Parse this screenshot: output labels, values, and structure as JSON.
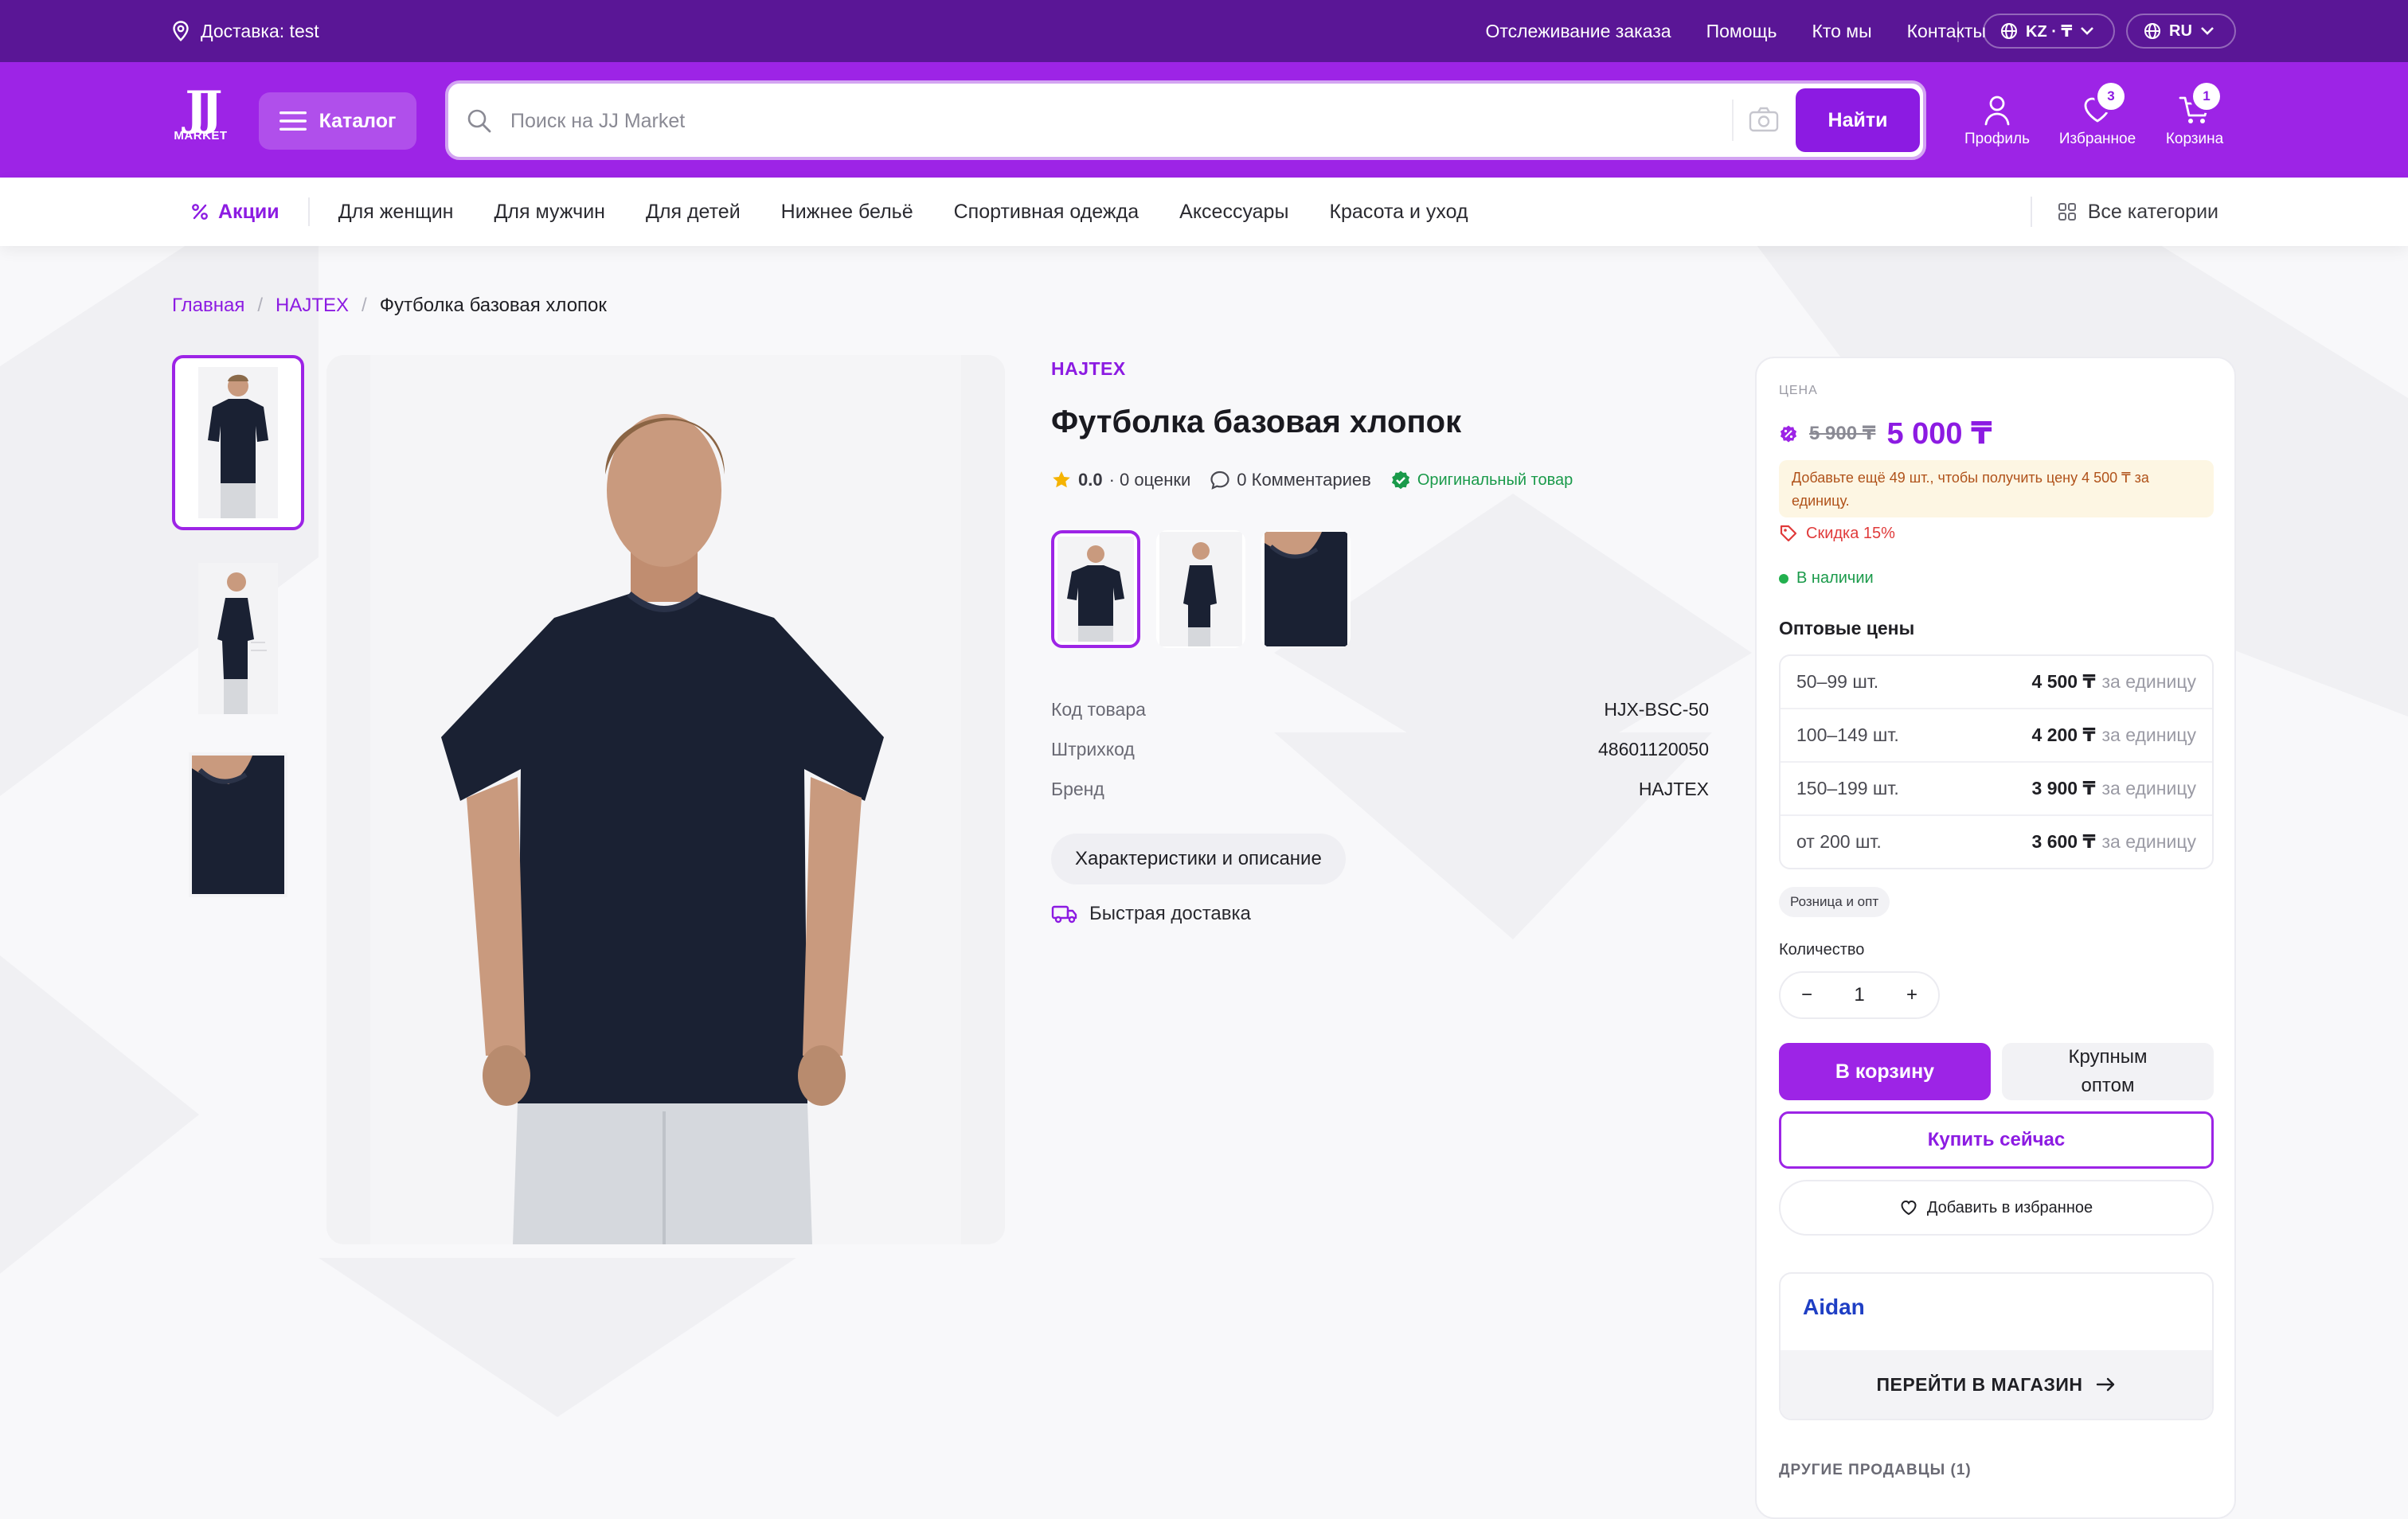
{
  "topbar": {
    "delivery": "Доставка: test",
    "links": [
      "Отслеживание заказа",
      "Помощь",
      "Кто мы",
      "Контакты"
    ],
    "region": "KZ · ₸",
    "language": "RU"
  },
  "header": {
    "logo_top": "JJ",
    "logo_bottom": "MARKET",
    "catalog_label": "Каталог",
    "search_placeholder": "Поиск на JJ Market",
    "search_button": "Найти",
    "profile_label": "Профиль",
    "favorites_label": "Избранное",
    "favorites_count": "3",
    "cart_label": "Корзина",
    "cart_count": "1"
  },
  "nav": {
    "promo": "Акции",
    "items": [
      "Для женщин",
      "Для мужчин",
      "Для детей",
      "Нижнее бельё",
      "Спортивная одежда",
      "Аксессуары",
      "Красота и уход"
    ],
    "all_categories": "Все категории"
  },
  "breadcrumb": {
    "home": "Главная",
    "brand": "HAJTEX",
    "current": "Футболка базовая хлопок"
  },
  "product": {
    "brand": "HAJTEX",
    "title": "Футболка базовая хлопок",
    "rating": "0.0",
    "ratings_count": "· 0 оценки",
    "comments": "0 Комментариев",
    "original": "Оригинальный товар",
    "specs": [
      {
        "key": "Код товара",
        "value": "HJX-BSC-50"
      },
      {
        "key": "Штрихкод",
        "value": "48601120050"
      },
      {
        "key": "Бренд",
        "value": "HAJTEX"
      }
    ],
    "characteristics_button": "Характеристики и описание",
    "fast_delivery": "Быстрая доставка"
  },
  "buy_panel": {
    "price_label": "ЦЕНА",
    "old_price": "5 900 ₸",
    "price": "5 000 ₸",
    "upsell_note": "Добавьте ещё 49 шт., чтобы получить цену 4 500 ₸ за единицу.",
    "discount": "Скидка 15%",
    "stock": "В наличии",
    "wholesale_title": "Оптовые цены",
    "wholesale": [
      {
        "qty": "50–99 шт.",
        "price": "4 500 ₸",
        "unit": "за единицу"
      },
      {
        "qty": "100–149 шт.",
        "price": "4 200 ₸",
        "unit": "за единицу"
      },
      {
        "qty": "150–199 шт.",
        "price": "3 900 ₸",
        "unit": "за единицу"
      },
      {
        "qty": "от 200 шт.",
        "price": "3 600 ₸",
        "unit": "за единицу"
      }
    ],
    "chip": "Розница и опт",
    "quantity_label": "Количество",
    "quantity": "1",
    "minus": "−",
    "plus": "+",
    "add_to_cart": "В корзину",
    "bulk_line1": "Крупным",
    "bulk_line2": "оптом",
    "buy_now": "Купить сейчас",
    "add_favorite": "Добавить в избранное",
    "store_name": "Aidan",
    "go_to_store": "ПЕРЕЙТИ В МАГАЗИН",
    "other_sellers": "ДРУГИЕ ПРОДАВЦЫ (1)"
  },
  "colors": {
    "topbar": "#5a1696",
    "header": "#9d24e6",
    "accent": "#8c1be2",
    "shirt": "#1a2133"
  }
}
